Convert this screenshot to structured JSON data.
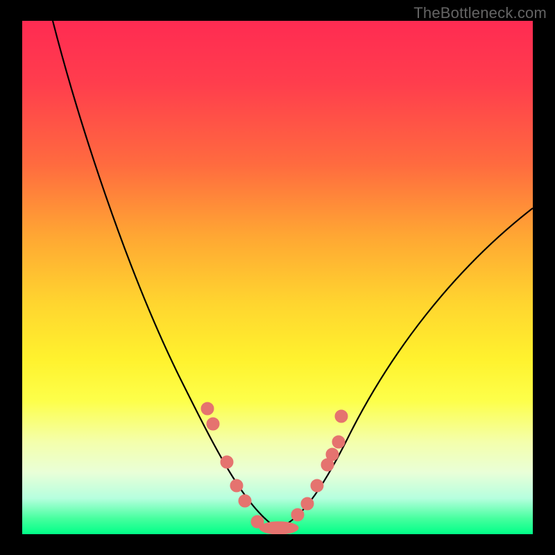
{
  "watermark": "TheBottleneck.com",
  "chart_data": {
    "type": "line",
    "title": "",
    "xlabel": "",
    "ylabel": "",
    "xlim": [
      0,
      100
    ],
    "ylim": [
      0,
      100
    ],
    "grid": false,
    "legend": false,
    "series": [
      {
        "name": "left-curve",
        "x": [
          6,
          10,
          15,
          20,
          25,
          30,
          34,
          38,
          41,
          44,
          46,
          48,
          50
        ],
        "y": [
          100,
          89,
          76,
          63,
          50,
          38,
          28,
          19,
          12,
          7,
          4,
          2,
          1
        ]
      },
      {
        "name": "right-curve",
        "x": [
          50,
          52,
          55,
          58,
          62,
          68,
          75,
          83,
          92,
          100
        ],
        "y": [
          1,
          2,
          5,
          9,
          15,
          24,
          34,
          45,
          55,
          63
        ]
      }
    ],
    "scatter": {
      "name": "highlight-points",
      "color": "#e5736f",
      "x": [
        36.2,
        37.4,
        40.1,
        42.0,
        43.6,
        46.0,
        49.0,
        51.5,
        54.0,
        55.8,
        57.8,
        59.8,
        60.7,
        61.9,
        62.5
      ],
      "y": [
        24.5,
        21.5,
        14.0,
        9.5,
        6.5,
        2.5,
        1.2,
        1.2,
        3.8,
        6.0,
        9.5,
        13.5,
        15.5,
        18.0,
        23.0
      ]
    },
    "background_gradient": {
      "top": "#ff2b52",
      "mid": "#ffe02f",
      "bottom": "#00ff88"
    }
  }
}
